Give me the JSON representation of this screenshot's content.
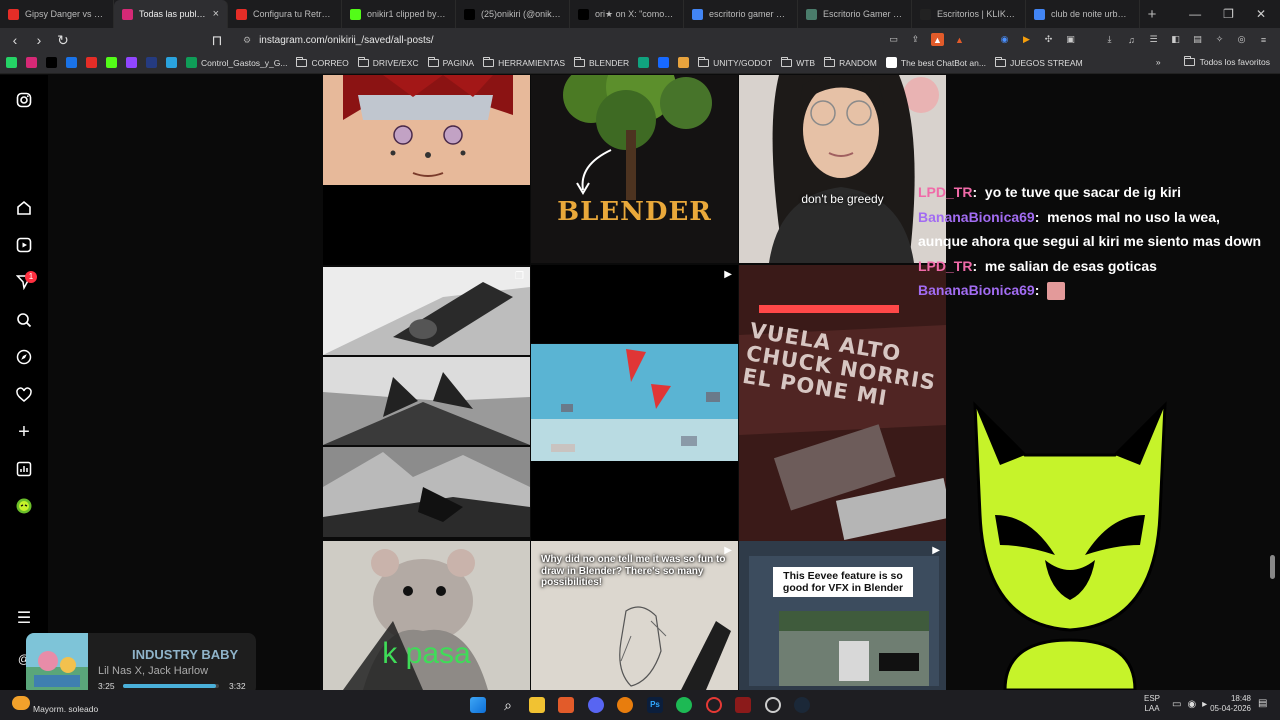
{
  "tabs": [
    {
      "title": "Gipsy Danger vs Otach",
      "icon": "youtube-icon",
      "color": "#e52d27",
      "active": false
    },
    {
      "title": "Todas las publicac",
      "icon": "instagram-icon",
      "color": "#d62976",
      "active": true
    },
    {
      "title": "Configura tu Retroid P",
      "icon": "youtube-icon",
      "color": "#e52d27",
      "active": false
    },
    {
      "title": "onikir1 clipped by Nel",
      "icon": "kick-icon",
      "color": "#53fc18",
      "active": false
    },
    {
      "title": "(25)onikiri (@onikir1) |",
      "icon": "tiktok-icon",
      "color": "#000000",
      "active": false
    },
    {
      "title": "ori★ on X: \"como esco",
      "icon": "x-icon",
      "color": "#000000",
      "active": false
    },
    {
      "title": "escritorio gamer XL - B",
      "icon": "google-icon",
      "color": "#4285f4",
      "active": false
    },
    {
      "title": "Escritorio Gamer XL 20",
      "icon": "page-icon",
      "color": "#4a7c6b",
      "active": false
    },
    {
      "title": "Escritorios | KLIK Mueb",
      "icon": "klik-icon",
      "color": "#222222",
      "active": false
    },
    {
      "title": "club de noite urban m",
      "icon": "google-icon",
      "color": "#4285f4",
      "active": false
    }
  ],
  "address": {
    "url": "instagram.com/onikirii_/saved/all-posts/"
  },
  "bookmarks": [
    {
      "label": "",
      "icon": "whatsapp-icon",
      "color": "#25d366"
    },
    {
      "label": "",
      "icon": "instagram-icon",
      "color": "#d62976"
    },
    {
      "label": "",
      "icon": "x-icon",
      "color": "#000000"
    },
    {
      "label": "",
      "icon": "trello-icon",
      "color": "#1a73e8"
    },
    {
      "label": "",
      "icon": "youtube-icon",
      "color": "#e52d27"
    },
    {
      "label": "",
      "icon": "kick-icon",
      "color": "#53fc18"
    },
    {
      "label": "",
      "icon": "twitch-icon",
      "color": "#9146ff"
    },
    {
      "label": "",
      "icon": "paypal-icon",
      "color": "#253b80"
    },
    {
      "label": "",
      "icon": "telegram-icon",
      "color": "#2aa3de"
    },
    {
      "label": "Control_Gastos_y_G...",
      "icon": "sheets-icon",
      "color": "#0f9d58"
    },
    {
      "label": "CORREO",
      "icon": "folder-icon"
    },
    {
      "label": "DRIVE/EXC",
      "icon": "folder-icon"
    },
    {
      "label": "PAGINA",
      "icon": "folder-icon"
    },
    {
      "label": "HERRAMIENTAS",
      "icon": "folder-icon"
    },
    {
      "label": "BLENDER",
      "icon": "folder-icon"
    },
    {
      "label": "",
      "icon": "chatgpt-icon",
      "color": "#10a37f"
    },
    {
      "label": "",
      "icon": "behance-icon",
      "color": "#1769ff"
    },
    {
      "label": "",
      "icon": "bookmark-icon",
      "color": "#e8a33d"
    },
    {
      "label": "UNITY/GODOT",
      "icon": "folder-icon"
    },
    {
      "label": "WTB",
      "icon": "folder-icon"
    },
    {
      "label": "RANDOM",
      "icon": "folder-icon"
    },
    {
      "label": "The best ChatBot an...",
      "icon": "chatbot-icon",
      "color": "#ffffff"
    },
    {
      "label": "JUEGOS STREAM",
      "icon": "folder-icon"
    }
  ],
  "bookmarks_all": "Todos los favoritos",
  "sidebar": {
    "notification_badge": "1"
  },
  "posts": [
    {
      "name": "post-anime-pain",
      "caption": ""
    },
    {
      "name": "post-blender-tree",
      "caption": "BLENDER"
    },
    {
      "name": "post-girl-glasses",
      "caption": "don't be greedy"
    },
    {
      "name": "post-car-bw-1",
      "caption": ""
    },
    {
      "name": "post-black-reel",
      "caption": ""
    },
    {
      "name": "post-car-red-window",
      "caption": "VUELA ALTO CHUCK NORRIS EL PONE MI"
    },
    {
      "name": "post-car-bw-2",
      "caption": ""
    },
    {
      "name": "post-sky-boats",
      "caption": ""
    },
    {
      "name": "post-car-bw-3",
      "caption": ""
    },
    {
      "name": "post-rat",
      "caption": "k pasa"
    },
    {
      "name": "post-blender-drawing",
      "caption": "Why did no one tell me it was so fun to draw in Blender? There's so many possibilities!"
    },
    {
      "name": "post-eevee-vfx",
      "caption": "This Eevee feature is so good for VFX in Blender"
    }
  ],
  "chat": [
    {
      "user": "LPD_TR",
      "color": "#f06aa8",
      "message": "yo te tuve que sacar de ig kiri"
    },
    {
      "user": "BananaBionica69",
      "color": "#a26cf2",
      "message": "menos mal no uso la wea, aunque ahora que segui al kiri me siento mas down"
    },
    {
      "user": "LPD_TR",
      "color": "#f06aa8",
      "message": "me salian de esas goticas"
    },
    {
      "user": "BananaBionica69",
      "color": "#a26cf2",
      "message": ""
    }
  ],
  "player": {
    "title": "INDUSTRY BABY",
    "artist": "Lil Nas X, Jack Harlow",
    "elapsed": "3:25",
    "duration": "3:32",
    "progress": 0.967
  },
  "taskbar": {
    "weather": "Mayorm. soleado",
    "language": "ESP",
    "layout": "LAA",
    "time": "18:48",
    "date": "05-04-2026"
  },
  "colors": {
    "mascot": "#c6f32a",
    "accent": "#e25b2a"
  }
}
